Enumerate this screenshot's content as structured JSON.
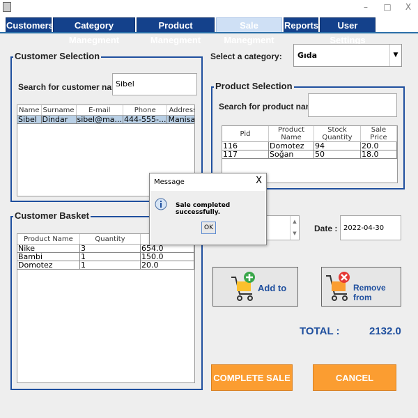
{
  "window": {
    "minimize": "–",
    "maximize": "□",
    "close": "X"
  },
  "tabs": [
    "Customers",
    "Category Manegment",
    "Product Manegment",
    "Sale Manegment",
    "Reports",
    "User Settings"
  ],
  "customer_selection": {
    "title": "Customer Selection",
    "search_label": "Search for customer name :",
    "search_value": "Sibel",
    "columns": [
      "Name",
      "Surname",
      "E-mail",
      "Phone",
      "Address"
    ],
    "rows": [
      [
        "Sibel",
        "Dindar",
        "sibel@ma...",
        "444-555-...",
        "Manisa"
      ]
    ]
  },
  "category": {
    "label": "Select a category:",
    "value": "Gıda"
  },
  "product_selection": {
    "title": "Product Selection",
    "search_label": "Search for product  name:",
    "columns": [
      "Pid",
      "Product Name",
      "Stock Quantity",
      "Sale Price"
    ],
    "rows": [
      [
        "116",
        "Domotez",
        "94",
        "20.0"
      ],
      [
        "117",
        "Soğan",
        "50",
        "18.0"
      ]
    ]
  },
  "basket": {
    "title": "Customer Basket",
    "columns": [
      "Product Name",
      "Quantity",
      ""
    ],
    "rows": [
      [
        "Nike",
        "3",
        "654.0"
      ],
      [
        "Bambi",
        "1",
        "150.0"
      ],
      [
        "Domotez",
        "1",
        "20.0"
      ]
    ]
  },
  "date": {
    "label": "Date :",
    "value": "2022-04-30"
  },
  "buttons": {
    "add": "Add to",
    "remove": "Remove from",
    "complete": "COMPLETE SALE",
    "cancel": "CANCEL",
    "ok": "OK"
  },
  "total": {
    "label": "TOTAL :",
    "value": "2132.0"
  },
  "dialog": {
    "title": "Message",
    "message": "Sale completed successfully.",
    "close": "X"
  },
  "colors": {
    "tab": "#14418b",
    "accent": "#1f4f9e",
    "orange": "#fb9d31"
  }
}
